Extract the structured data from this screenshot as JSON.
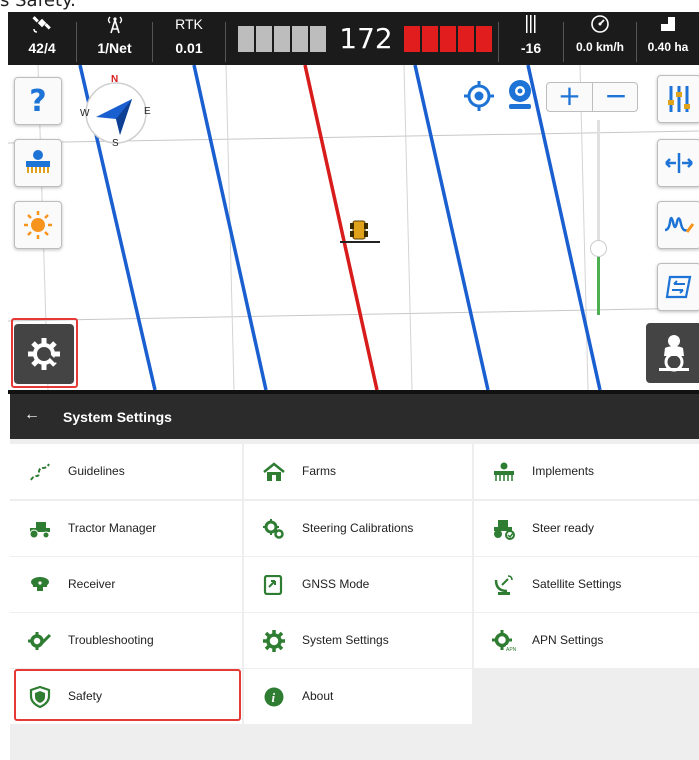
{
  "caption": {
    "text": "s Safety."
  },
  "status_bar": {
    "items": [
      {
        "icon": "satellite-icon",
        "value": "42/4"
      },
      {
        "icon": "signal-tower-icon",
        "value": "1/Net"
      },
      {
        "label": "RTK",
        "value": "0.01"
      }
    ],
    "lightbar": {
      "offset": "172"
    },
    "right_items": [
      {
        "icon": "steering-angle-icon",
        "value": "-16"
      },
      {
        "icon": "speedometer-icon",
        "value": "0.0 km/h"
      },
      {
        "icon": "area-icon",
        "value": "0.40 ha"
      }
    ]
  },
  "map": {
    "compass": {
      "north": "N",
      "south": "S",
      "east": "E",
      "west": "W"
    },
    "zoom": {
      "plus": "+",
      "minus": "−"
    }
  },
  "colors": {
    "guideline_blue": "#1a5fd0",
    "active_line_red": "#d81b1b",
    "accent_green": "#2e7d32",
    "highlight_red": "#e53935",
    "lightbar_red": "#e11d1d",
    "lightbar_gray": "#bdbdbd"
  },
  "settings": {
    "back": "←",
    "title": "System Settings",
    "items": [
      {
        "label": "Guidelines",
        "icon": "guidelines-icon"
      },
      {
        "label": "Farms",
        "icon": "farm-icon"
      },
      {
        "label": "Implements",
        "icon": "implement-icon"
      },
      {
        "label": "Tractor Manager",
        "icon": "tractor-icon"
      },
      {
        "label": "Steering Calibrations",
        "icon": "steering-calibration-icon"
      },
      {
        "label": "Steer ready",
        "icon": "steer-ready-icon"
      },
      {
        "label": "Receiver",
        "icon": "receiver-icon"
      },
      {
        "label": "GNSS Mode",
        "icon": "gnss-mode-icon"
      },
      {
        "label": "Satellite Settings",
        "icon": "satellite-settings-icon"
      },
      {
        "label": "Troubleshooting",
        "icon": "troubleshooting-icon"
      },
      {
        "label": "System Settings",
        "icon": "system-settings-icon"
      },
      {
        "label": "APN Settings",
        "icon": "apn-settings-icon"
      },
      {
        "label": "Safety",
        "icon": "safety-icon"
      },
      {
        "label": "About",
        "icon": "about-icon"
      }
    ]
  }
}
